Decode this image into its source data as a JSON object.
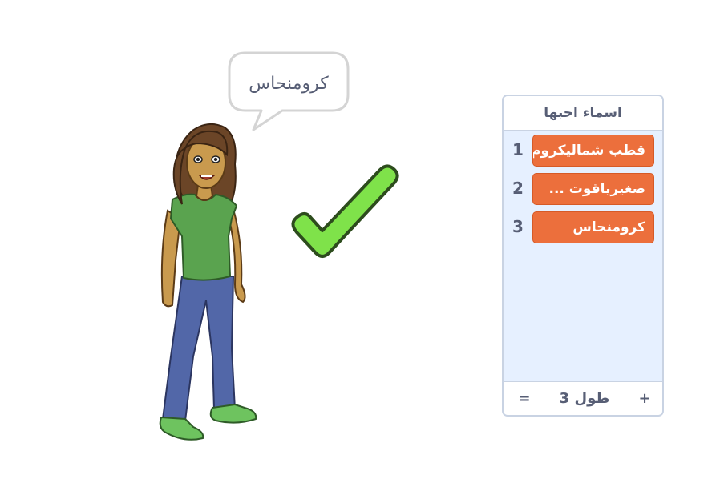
{
  "speech_bubble": {
    "text": "كرومنحاس"
  },
  "list_monitor": {
    "title": "اسماء احبها",
    "items": [
      {
        "index": "1",
        "value": "قطب شماليكروم"
      },
      {
        "index": "2",
        "value": "صغيرياقوت ..."
      },
      {
        "index": "3",
        "value": "كرومنحاس"
      }
    ],
    "footer": {
      "add": "+",
      "length_label": "طول 3",
      "resize": "="
    }
  },
  "colors": {
    "list_item_bg": "#ec6f3c",
    "list_bg": "#e6f0ff",
    "text": "#575e75",
    "check_fill": "#7fe24a",
    "shirt": "#5aa34f",
    "jeans": "#5267a8",
    "shoes": "#6ec35f"
  },
  "icons": {
    "checkmark": "checkmark-icon"
  }
}
